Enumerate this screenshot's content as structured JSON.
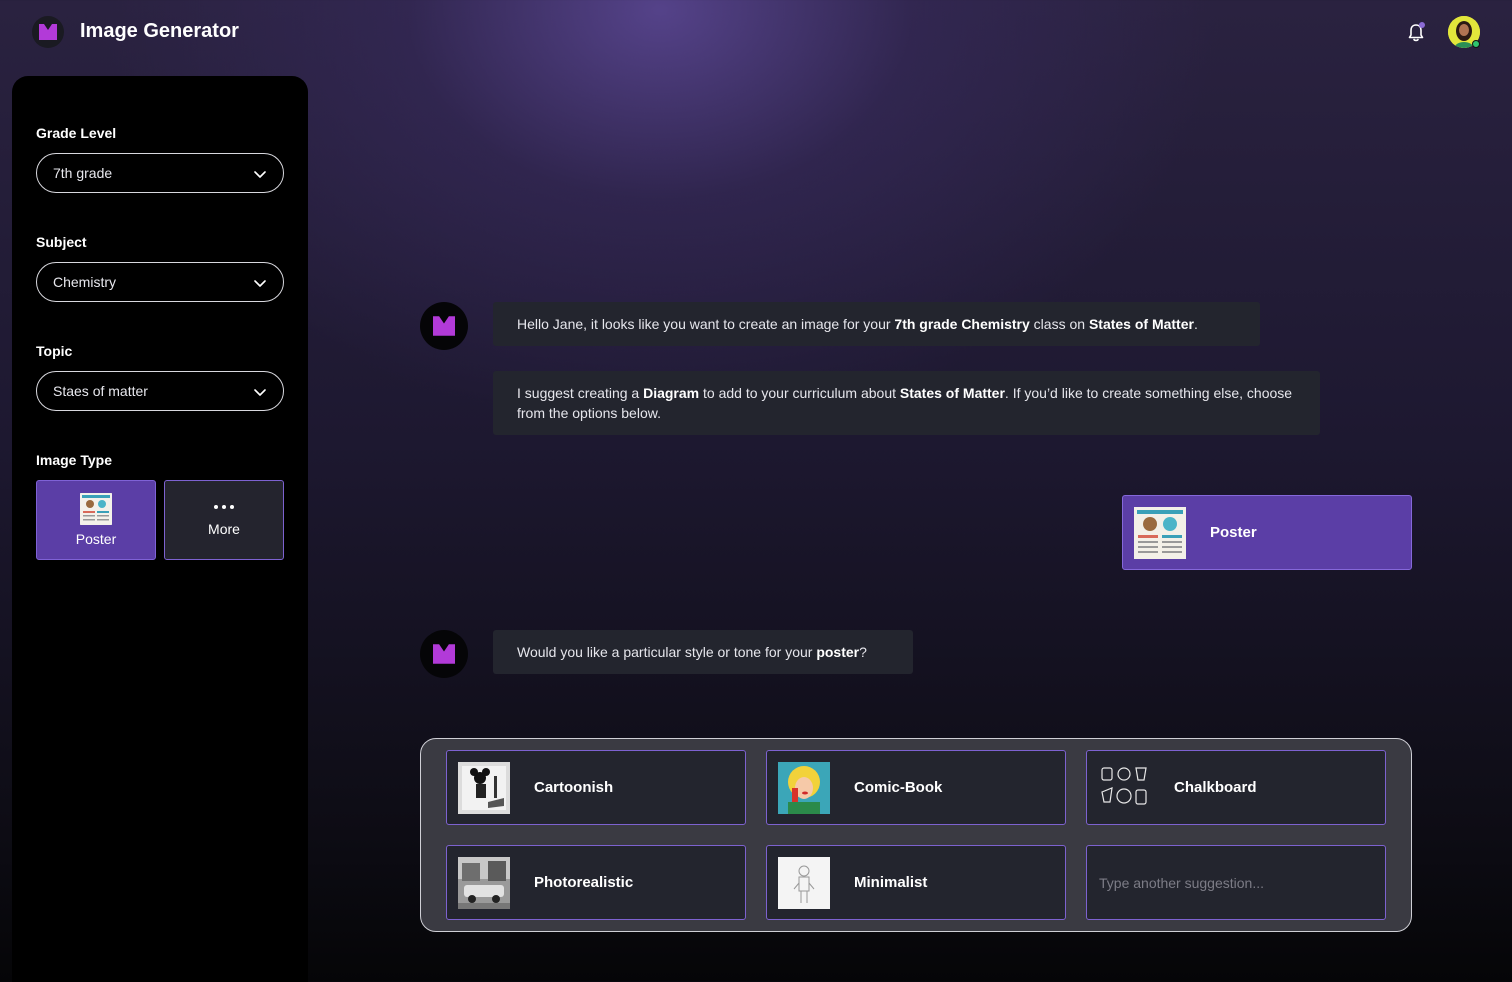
{
  "app": {
    "title": "Image Generator"
  },
  "header": {
    "notification_icon": "bell-icon",
    "avatar_label": "user-avatar"
  },
  "colors": {
    "accent": "#5b3ea6",
    "accent_border": "#7d62d0",
    "bubble_bg": "#23252e",
    "logo": "#b23ad8"
  },
  "sidebar": {
    "grade": {
      "label": "Grade Level",
      "value": "7th grade"
    },
    "subject": {
      "label": "Subject",
      "value": "Chemistry"
    },
    "topic": {
      "label": "Topic",
      "value": "Staes of matter"
    },
    "image_type": {
      "label": "Image Type",
      "options": [
        {
          "label": "Poster",
          "selected": true
        },
        {
          "label": "More",
          "selected": false
        }
      ]
    }
  },
  "chat": {
    "msg1": {
      "a": "Hello Jane, it looks like you want to create an image for your ",
      "b": "7th grade Chemistry",
      "c": " class on ",
      "d": "States of Matter",
      "e": "."
    },
    "msg2": {
      "a": "I suggest creating a ",
      "b": "Diagram",
      "c": " to add to your curriculum about ",
      "d": "States of Matter",
      "e": ". If you’d like to create something else, choose from the options below."
    },
    "user_choice": "Poster",
    "msg3": {
      "a": "Would you like a particular style or tone for your ",
      "b": "poster",
      "c": "?"
    }
  },
  "styles": {
    "options": [
      "Cartoonish",
      "Comic-Book",
      "Chalkboard",
      "Photorealistic",
      "Minimalist"
    ],
    "input_placeholder": "Type another suggestion..."
  }
}
